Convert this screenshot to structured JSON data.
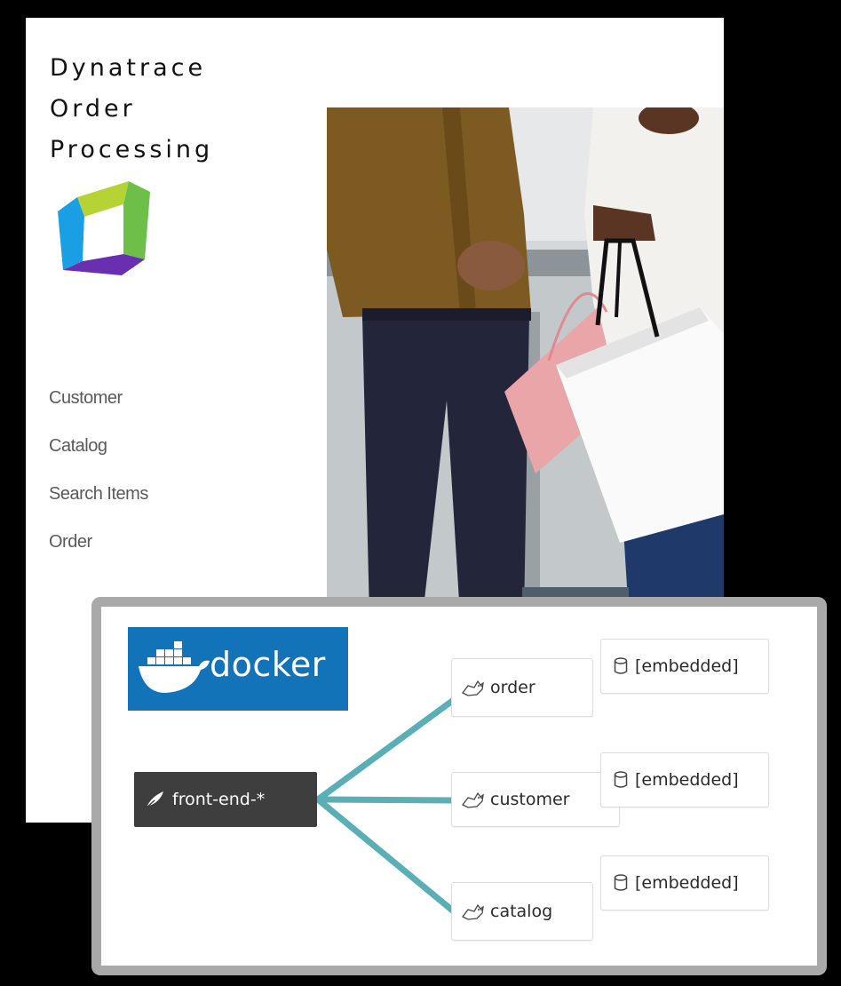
{
  "app": {
    "title_lines": [
      "Dynatrace",
      "Order",
      "Processing"
    ],
    "logo_icon": "dynatrace-logo-icon"
  },
  "nav": {
    "items": [
      {
        "label": "Customer"
      },
      {
        "label": "Catalog"
      },
      {
        "label": "Search Items"
      },
      {
        "label": "Order"
      }
    ]
  },
  "architecture": {
    "docker": {
      "label": "docker",
      "color": "#1273b9",
      "icon": "docker-whale-icon"
    },
    "frontend": {
      "label": "front-end-*",
      "icon": "feather-icon"
    },
    "services": [
      {
        "label": "order",
        "icon": "tomcat-icon"
      },
      {
        "label": "customer",
        "icon": "tomcat-icon"
      },
      {
        "label": "catalog",
        "icon": "tomcat-icon"
      }
    ],
    "databases": [
      {
        "label": "[embedded]",
        "icon": "database-icon"
      },
      {
        "label": "[embedded]",
        "icon": "database-icon"
      },
      {
        "label": "[embedded]",
        "icon": "database-icon"
      }
    ],
    "link_color": "#5aaeb6"
  }
}
